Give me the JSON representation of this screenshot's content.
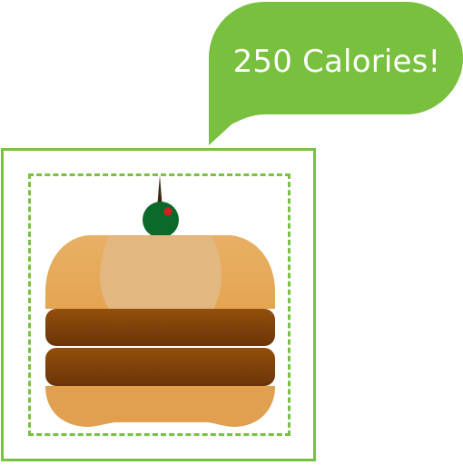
{
  "callout": {
    "text": "250 Calories!",
    "color": "#78c03e"
  },
  "colors": {
    "frame": "#79c141",
    "bun_top": "#e6ad5d",
    "bun_top_highlight": "#e2b77f",
    "patty_light": "#8c4a0a",
    "patty_dark": "#6a3208",
    "bun_bottom": "#e0a04f",
    "olive": "#0c6b2a",
    "pimento": "#d51f1f",
    "toothpick": "#3c2a10"
  },
  "icons": {
    "main": "burger-icon",
    "topping": "olive-icon"
  }
}
